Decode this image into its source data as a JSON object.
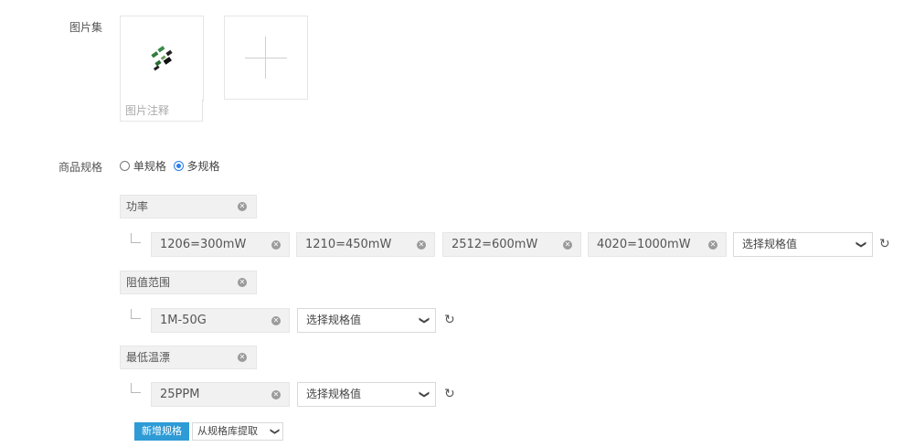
{
  "gallery": {
    "label": "图片集",
    "caption_placeholder": "图片注释",
    "thumbnail_icon": "product-thumbnail",
    "add_icon": "plus-icon"
  },
  "spec": {
    "label": "商品规格",
    "options": [
      {
        "label": "单规格",
        "checked": false
      },
      {
        "label": "多规格",
        "checked": true
      }
    ],
    "groups": [
      {
        "name": "功率",
        "values": [
          "1206=300mW",
          "1210=450mW",
          "2512=600mW",
          "4020=1000mW"
        ],
        "select_placeholder": "选择规格值"
      },
      {
        "name": "阻值范围",
        "values": [
          "1M-50G"
        ],
        "select_placeholder": "选择规格值"
      },
      {
        "name": "最低温漂",
        "values": [
          "25PPM"
        ],
        "select_placeholder": "选择规格值"
      }
    ],
    "add_button": "新增规格",
    "library_select": "从规格库提取"
  },
  "colors": {
    "accent": "#2e9bd6",
    "radio": "#2a7ee8"
  }
}
